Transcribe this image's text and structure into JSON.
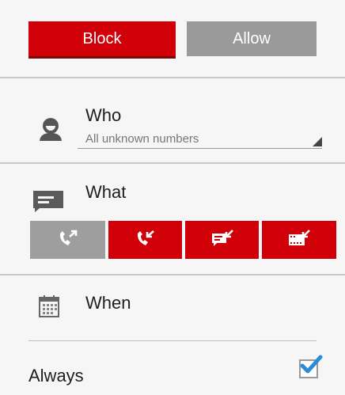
{
  "header": {
    "block_label": "Block",
    "allow_label": "Allow"
  },
  "who": {
    "title": "Who",
    "value": "All unknown numbers"
  },
  "what": {
    "title": "What",
    "actions": [
      {
        "icon": "outgoing-call-icon",
        "state": "gray"
      },
      {
        "icon": "incoming-call-icon",
        "state": "red"
      },
      {
        "icon": "incoming-sms-icon",
        "state": "red"
      },
      {
        "icon": "incoming-mms-icon",
        "state": "red"
      }
    ]
  },
  "when": {
    "title": "When"
  },
  "always": {
    "label": "Always",
    "checked": true
  },
  "colors": {
    "accent": "#d10008",
    "inactive": "#9e9e9e",
    "check": "#2a8bd6"
  }
}
